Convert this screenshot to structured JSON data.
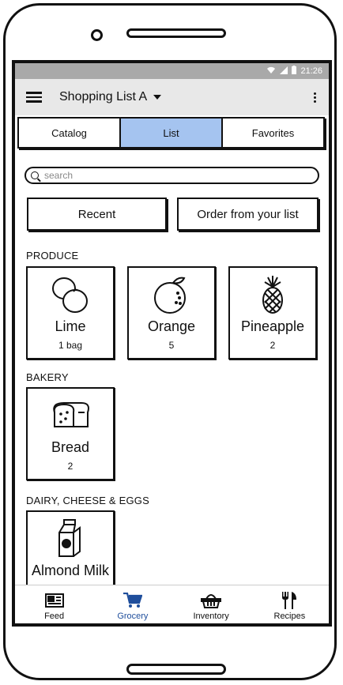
{
  "status_bar": {
    "time": "21:26"
  },
  "app_bar": {
    "title": "Shopping List A"
  },
  "tabs": [
    {
      "label": "Catalog",
      "active": false
    },
    {
      "label": "List",
      "active": true
    },
    {
      "label": "Favorites",
      "active": false
    }
  ],
  "search": {
    "placeholder": "search",
    "value": ""
  },
  "quick_actions": {
    "recent": "Recent",
    "order": "Order from your list"
  },
  "sections": [
    {
      "title": "PRODUCE",
      "items": [
        {
          "name": "Lime",
          "qty": "1 bag",
          "icon": "lime-icon"
        },
        {
          "name": "Orange",
          "qty": "5",
          "icon": "orange-icon"
        },
        {
          "name": "Pineapple",
          "qty": "2",
          "icon": "pineapple-icon"
        }
      ]
    },
    {
      "title": "BAKERY",
      "items": [
        {
          "name": "Bread",
          "qty": "2",
          "icon": "bread-icon"
        }
      ]
    },
    {
      "title": "DAIRY, CHEESE & EGGS",
      "items": [
        {
          "name": "Almond Milk",
          "qty": "",
          "icon": "milk-carton-icon"
        }
      ]
    }
  ],
  "bottom_nav": [
    {
      "label": "Feed",
      "icon": "newspaper-icon",
      "active": false
    },
    {
      "label": "Grocery",
      "icon": "cart-icon",
      "active": true
    },
    {
      "label": "Inventory",
      "icon": "basket-icon",
      "active": false
    },
    {
      "label": "Recipes",
      "icon": "fork-knife-icon",
      "active": false
    }
  ],
  "colors": {
    "active_tab": "#a5c4f0",
    "active_nav": "#1f4e9c",
    "status_bar": "#a9a9a9",
    "app_bar": "#e8e8e8"
  }
}
